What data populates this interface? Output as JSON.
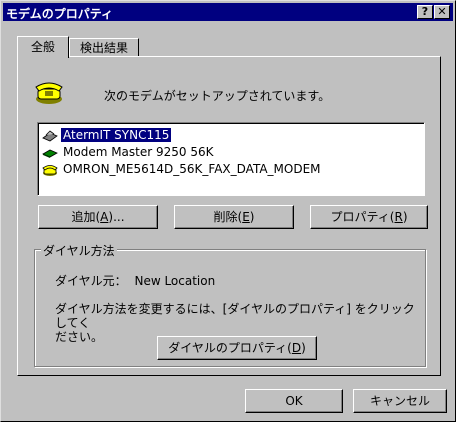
{
  "window": {
    "title": "モデムのプロパティ",
    "help_btn": "?",
    "close_btn": "✕"
  },
  "tabs": [
    {
      "label": "全般"
    },
    {
      "label": "検出結果"
    }
  ],
  "intro_text": "次のモデムがセットアップされています。",
  "modems": [
    {
      "name": "AtermIT SYNC115",
      "selected": true,
      "icon": "modem-gray-icon"
    },
    {
      "name": "Modem Master 9250 56K",
      "selected": false,
      "icon": "modem-green-icon"
    },
    {
      "name": "OMRON_ME5614D_56K_FAX_DATA_MODEM",
      "selected": false,
      "icon": "phone-icon"
    }
  ],
  "buttons": {
    "add": {
      "text": "追加(",
      "key": "A",
      "tail": ")..."
    },
    "delete": {
      "text": "削除(",
      "key": "E",
      "tail": ")"
    },
    "props": {
      "text": "プロパティ(",
      "key": "R",
      "tail": ")"
    }
  },
  "dial": {
    "group_label": "ダイヤル方法",
    "from_label": "ダイヤル元：",
    "from_value": "New Location",
    "instruction_line1": "ダイヤル方法を変更するには、[ダイヤルのプロパティ] をクリックしてく",
    "instruction_line2": "ださい。",
    "button": {
      "text": "ダイヤルのプロパティ(",
      "key": "D",
      "tail": ")"
    }
  },
  "footer": {
    "ok": "OK",
    "cancel": "キャンセル"
  }
}
